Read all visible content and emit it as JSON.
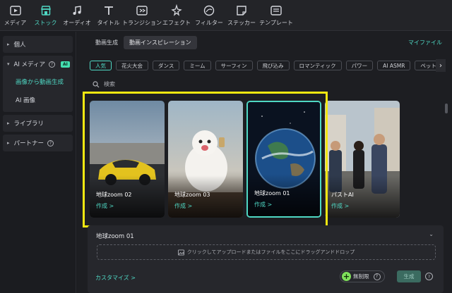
{
  "toolbar": {
    "items": [
      {
        "label": "メディア",
        "icon": "media-icon"
      },
      {
        "label": "ストック",
        "icon": "stock-icon",
        "active": true
      },
      {
        "label": "オーディオ",
        "icon": "music-note-icon"
      },
      {
        "label": "タイトル",
        "icon": "title-text-icon"
      },
      {
        "label": "トランジション",
        "icon": "transition-icon"
      },
      {
        "label": "エフェクト",
        "icon": "effect-sparkle-icon"
      },
      {
        "label": "フィルター",
        "icon": "filter-icon"
      },
      {
        "label": "ステッカー",
        "icon": "sticker-icon"
      },
      {
        "label": "テンプレート",
        "icon": "template-icon"
      }
    ]
  },
  "sidebar": {
    "personal": "個人",
    "ai_media": "AI メディア",
    "ai_badge": "AI",
    "sub_items": [
      "画像から動画生成",
      "AI 画像"
    ],
    "library": "ライブラリ",
    "partner": "パートナー"
  },
  "tabs": [
    "動画生成",
    "動画インスピレーション"
  ],
  "active_tab": "動画インスピレーション",
  "my_file": "マイファイル",
  "chips": [
    "人気",
    "花火大会",
    "ダンス",
    "ミーム",
    "サーフィン",
    "飛び込み",
    "ロマンティック",
    "パワー",
    "AI ASMR",
    "ペット&"
  ],
  "search": {
    "placeholder": "検索"
  },
  "cards": [
    {
      "title": "地球zoom 02",
      "action": "作成 >"
    },
    {
      "title": "地球zoom 03",
      "action": "作成 >"
    },
    {
      "title": "地球zoom 01",
      "action": "作成 >",
      "selected": true
    },
    {
      "title": "パストAI",
      "action": "作成 >"
    }
  ],
  "panel": {
    "title": "地球zoom 01",
    "upload_text": "クリックしてアップロードまたはファイルをここにドラッグアンドドロップ",
    "customize": "カスタマイズ >",
    "unlimited": "無制限",
    "generate": "生成"
  },
  "colors": {
    "accent": "#4fd8c4",
    "highlight": "#f2e711",
    "ai_badge": "#43e0b0"
  }
}
